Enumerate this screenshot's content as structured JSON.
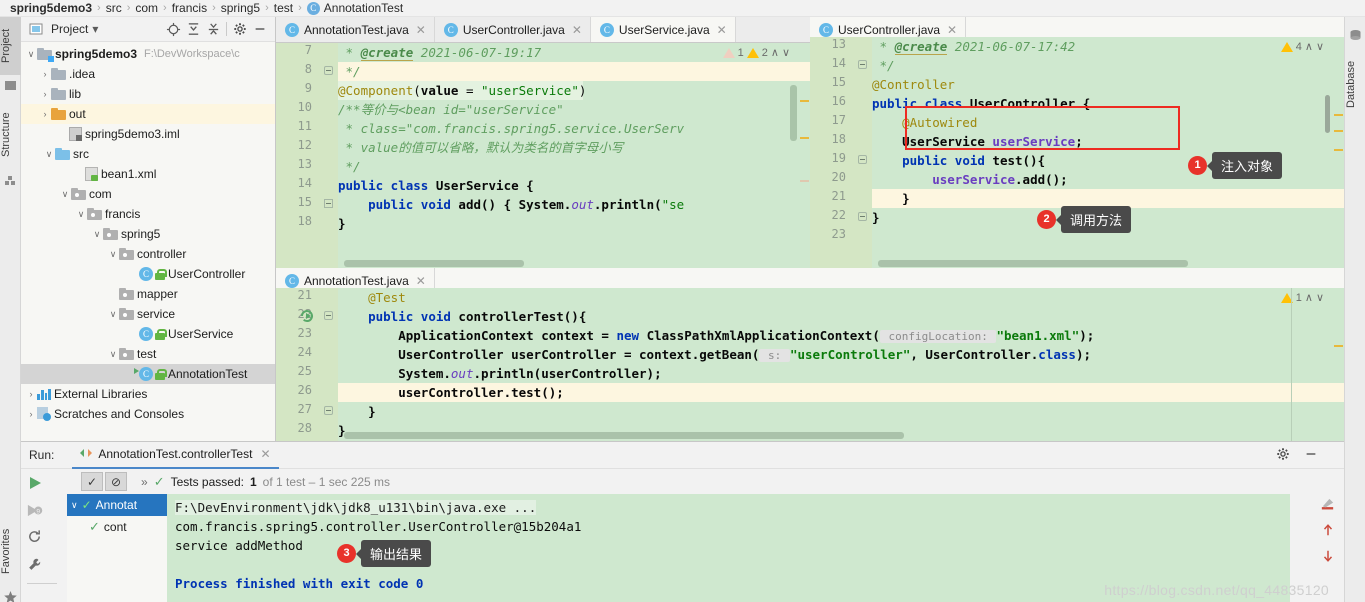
{
  "breadcrumb": {
    "items": [
      "spring5demo3",
      "src",
      "com",
      "francis",
      "spring5",
      "test",
      "AnnotationTest"
    ],
    "class_icon": "class-icon"
  },
  "left_strip": {
    "tabs": [
      {
        "label": "Project",
        "icon": "project-icon",
        "selected": true
      },
      {
        "label": "Structure",
        "icon": "structure-icon",
        "selected": false
      },
      {
        "label": "Favorites",
        "icon": "star-icon",
        "selected": false
      }
    ]
  },
  "right_strip": {
    "tabs": [
      {
        "label": "Database",
        "icon": "database-icon"
      }
    ]
  },
  "project_panel": {
    "title": "Project",
    "toolbar_icons": [
      "locate-icon",
      "expand-all-icon",
      "collapse-all-icon",
      "gear-icon",
      "hide-icon"
    ],
    "tree": [
      {
        "label": "spring5demo3",
        "path": "F:\\DevWorkspace\\c",
        "indent": 0,
        "arrow": "∨",
        "icon": "module-folder-icon",
        "bold": true
      },
      {
        "label": ".idea",
        "path": "",
        "indent": 1,
        "arrow": "›",
        "icon": "folder-icon",
        "bold": false
      },
      {
        "label": "lib",
        "path": "",
        "indent": 1,
        "arrow": "›",
        "icon": "folder-icon",
        "bold": false
      },
      {
        "label": "out",
        "path": "",
        "indent": 1,
        "arrow": "›",
        "icon": "folder-orange-icon",
        "bold": false,
        "highlight": true
      },
      {
        "label": "spring5demo3.iml",
        "path": "",
        "indent": 2,
        "arrow": "",
        "icon": "iml-file-icon",
        "bold": false
      },
      {
        "label": "src",
        "path": "",
        "indent": 1,
        "arrow": "∨",
        "icon": "source-folder-icon",
        "bold": false
      },
      {
        "label": "bean1.xml",
        "path": "",
        "indent": 3,
        "arrow": "",
        "icon": "xml-file-icon",
        "bold": false
      },
      {
        "label": "com",
        "path": "",
        "indent": 2,
        "arrow": "∨",
        "icon": "package-icon",
        "bold": false
      },
      {
        "label": "francis",
        "path": "",
        "indent": 3,
        "arrow": "∨",
        "icon": "package-icon",
        "bold": false
      },
      {
        "label": "spring5",
        "path": "",
        "indent": 4,
        "arrow": "∨",
        "icon": "package-icon",
        "bold": false
      },
      {
        "label": "controller",
        "path": "",
        "indent": 5,
        "arrow": "∨",
        "icon": "package-icon",
        "bold": false
      },
      {
        "label": "UserController",
        "path": "",
        "indent": 7,
        "arrow": "",
        "icon": "java-class-icon",
        "bold": false
      },
      {
        "label": "mapper",
        "path": "",
        "indent": 5,
        "arrow": "",
        "icon": "package-icon",
        "bold": false
      },
      {
        "label": "service",
        "path": "",
        "indent": 5,
        "arrow": "∨",
        "icon": "package-icon",
        "bold": false
      },
      {
        "label": "UserService",
        "path": "",
        "indent": 7,
        "arrow": "",
        "icon": "java-class-icon",
        "bold": false
      },
      {
        "label": "test",
        "path": "",
        "indent": 5,
        "arrow": "∨",
        "icon": "package-icon",
        "bold": false
      },
      {
        "label": "AnnotationTest",
        "path": "",
        "indent": 7,
        "arrow": "",
        "icon": "java-test-class-icon",
        "bold": false,
        "selected": true
      },
      {
        "label": "External Libraries",
        "path": "",
        "indent": 0,
        "arrow": "›",
        "icon": "libraries-icon",
        "bold": false
      },
      {
        "label": "Scratches and Consoles",
        "path": "",
        "indent": 0,
        "arrow": "›",
        "icon": "scratches-icon",
        "bold": false
      }
    ]
  },
  "editor_left": {
    "tabs": [
      {
        "label": "AnnotationTest.java",
        "icon": "test-class-icon",
        "active": false
      },
      {
        "label": "UserController.java",
        "icon": "class-icon",
        "active": false
      },
      {
        "label": "UserService.java",
        "icon": "class-icon",
        "active": true
      }
    ],
    "warnings": {
      "pale_count": "1",
      "yellow_count": "2",
      "up": "∧",
      "down": "∨"
    },
    "lines": [
      {
        "no": "7",
        "segments": [
          {
            "t": " * ",
            "c": "cmt"
          },
          {
            "t": "@create",
            "c": "cmtb"
          },
          {
            "t": " 2021-06-07-19:17",
            "c": "cmt"
          }
        ]
      },
      {
        "no": "8",
        "segments": [
          {
            "t": " */",
            "c": "cmt"
          }
        ]
      },
      {
        "no": "9",
        "highlight": "yellow",
        "segments": [
          {
            "t": "@Component",
            "c": "anno"
          },
          {
            "t": "(",
            "c": "plain"
          },
          {
            "t": "value",
            "c": "plain"
          },
          {
            "t": " = ",
            "c": "plain"
          },
          {
            "t": "\"userService\"",
            "c": "str"
          },
          {
            "t": ")",
            "c": "plain"
          }
        ]
      },
      {
        "no": "10",
        "segments": [
          {
            "t": "/**等价与<bean id=\"userService\"",
            "c": "cmt"
          }
        ]
      },
      {
        "no": "11",
        "segments": [
          {
            "t": " * class=\"com.francis.spring5.service.UserServ",
            "c": "cmt"
          }
        ]
      },
      {
        "no": "12",
        "segments": [
          {
            "t": " * value的值可以省略，默认为类名的首字母小写",
            "c": "cmt"
          }
        ]
      },
      {
        "no": "13",
        "segments": [
          {
            "t": " */",
            "c": "cmt"
          }
        ]
      },
      {
        "no": "14",
        "segments": [
          {
            "t": "public class ",
            "c": "kw"
          },
          {
            "t": "UserService {",
            "c": "plain"
          }
        ]
      },
      {
        "no": "15",
        "segments": [
          {
            "t": "    public void ",
            "c": "kw"
          },
          {
            "t": "add() { ",
            "c": "plain"
          },
          {
            "t": "System.",
            "c": "plain"
          },
          {
            "t": "out",
            "c": "fld"
          },
          {
            "t": ".println(",
            "c": "plain"
          },
          {
            "t": "\"se",
            "c": "str"
          }
        ]
      },
      {
        "no": "18",
        "segments": [
          {
            "t": "}",
            "c": "plain"
          }
        ]
      }
    ]
  },
  "editor_right": {
    "tabs": [
      {
        "label": "UserController.java",
        "icon": "class-icon",
        "active": true
      }
    ],
    "warnings": {
      "yellow_count": "4",
      "up": "∧",
      "down": "∨"
    },
    "lines": [
      {
        "no": "13",
        "segments": [
          {
            "t": " * ",
            "c": "cmt"
          },
          {
            "t": "@create",
            "c": "cmtb"
          },
          {
            "t": " 2021-06-07-17:42",
            "c": "cmt"
          }
        ]
      },
      {
        "no": "14",
        "segments": [
          {
            "t": " */",
            "c": "cmt"
          }
        ]
      },
      {
        "no": "15",
        "segments": [
          {
            "t": "@Controller",
            "c": "anno"
          }
        ]
      },
      {
        "no": "16",
        "segments": [
          {
            "t": "public class ",
            "c": "kw"
          },
          {
            "t": "UserController {",
            "c": "plain"
          }
        ]
      },
      {
        "no": "17",
        "segments": [
          {
            "t": "    @Autowired",
            "c": "anno"
          }
        ]
      },
      {
        "no": "18",
        "segments": [
          {
            "t": "    UserService ",
            "c": "plain"
          },
          {
            "t": "userService",
            "c": "fld"
          },
          {
            "t": ";",
            "c": "plain"
          }
        ]
      },
      {
        "no": "19",
        "segments": [
          {
            "t": "    public void ",
            "c": "kw"
          },
          {
            "t": "test(){",
            "c": "plain"
          }
        ]
      },
      {
        "no": "20",
        "highlight": "yellow",
        "segments": [
          {
            "t": "        ",
            "c": "plain"
          },
          {
            "t": "userService",
            "c": "fld"
          },
          {
            "t": ".add();",
            "c": "plain"
          }
        ]
      },
      {
        "no": "21",
        "segments": [
          {
            "t": "    }",
            "c": "plain"
          }
        ]
      },
      {
        "no": "22",
        "segments": [
          {
            "t": "}",
            "c": "plain"
          }
        ]
      },
      {
        "no": "23",
        "segments": [
          {
            "t": "",
            "c": "plain"
          }
        ]
      }
    ]
  },
  "editor_bottom": {
    "tabs": [
      {
        "label": "AnnotationTest.java",
        "icon": "test-class-icon",
        "active": true
      }
    ],
    "warnings": {
      "yellow_count": "1",
      "up": "∧",
      "down": "∨"
    },
    "lines": [
      {
        "no": "21",
        "segments": [
          {
            "t": "    @Test",
            "c": "anno"
          }
        ]
      },
      {
        "no": "22",
        "gutter_icon": "run-test-icon",
        "segments": [
          {
            "t": "    public void ",
            "c": "kw"
          },
          {
            "t": "controllerTest(){",
            "c": "plain"
          }
        ]
      },
      {
        "no": "23",
        "segments": [
          {
            "t": "        ApplicationContext context = ",
            "c": "plain"
          },
          {
            "t": "new ",
            "c": "kw"
          },
          {
            "t": "ClassPathXmlApplicationContext(",
            "c": "plain"
          },
          {
            "t": " configLocation: ",
            "c": "hint"
          },
          {
            "t": "\"bean1.xml\"",
            "c": "str"
          },
          {
            "t": ");",
            "c": "plain"
          }
        ]
      },
      {
        "no": "24",
        "segments": [
          {
            "t": "        UserController userController = context.getBean(",
            "c": "plain"
          },
          {
            "t": " s: ",
            "c": "hint"
          },
          {
            "t": "\"userController\"",
            "c": "str"
          },
          {
            "t": ", UserController.",
            "c": "plain"
          },
          {
            "t": "class",
            "c": "kw"
          },
          {
            "t": ");",
            "c": "plain"
          }
        ]
      },
      {
        "no": "25",
        "segments": [
          {
            "t": "        System.",
            "c": "plain"
          },
          {
            "t": "out",
            "c": "fld"
          },
          {
            "t": ".println(userController);",
            "c": "plain"
          }
        ]
      },
      {
        "no": "26",
        "highlight": "yellow",
        "segments": [
          {
            "t": "        userController.test();",
            "c": "plain"
          }
        ]
      },
      {
        "no": "27",
        "segments": [
          {
            "t": "    }",
            "c": "plain"
          }
        ]
      },
      {
        "no": "28",
        "segments": [
          {
            "t": "}",
            "c": "plain"
          }
        ]
      }
    ]
  },
  "callouts": [
    {
      "num": "1",
      "text": "注入对象"
    },
    {
      "num": "2",
      "text": "调用方法"
    },
    {
      "num": "3",
      "text": "输出结果"
    }
  ],
  "run_panel": {
    "label": "Run:",
    "tab_label": "AnnotationTest.controllerTest",
    "tab_icon": "run-config-icon",
    "toolbar_icons": [
      "rerun-icon",
      "rerun-failed-icon",
      "stop-icon",
      "debug-icon",
      "restart-icon",
      "wrench-icon"
    ],
    "status": {
      "expand": "»",
      "passed_label": "Tests passed:",
      "passed_count": "1",
      "detail": "of 1 test – 1 sec 225 ms"
    },
    "tests_tree": [
      {
        "label": "Annotat",
        "selected": true,
        "arrow": "∨"
      },
      {
        "label": "cont",
        "selected": false,
        "arrow": ""
      }
    ],
    "console_lines": [
      {
        "text": "F:\\DevEnvironment\\jdk\\jdk8_u131\\bin\\java.exe ...",
        "style": "dim"
      },
      {
        "text": "com.francis.spring5.controller.UserController@15b204a1",
        "style": "normal"
      },
      {
        "text": "service addMethod",
        "style": "normal"
      },
      {
        "text": "",
        "style": "normal"
      },
      {
        "text": "Process finished with exit code 0",
        "style": "blue"
      }
    ],
    "right_icons": [
      "soft-wrap-icon",
      "scroll-up-icon",
      "scroll-down-icon"
    ],
    "window_icons": [
      "gear-icon",
      "minimize-icon"
    ]
  },
  "watermark": "https://blog.csdn.net/qq_44835120",
  "colors": {
    "editor_bg": "#cfe8cf",
    "gutter_bg": "#d4e6c4",
    "highlight_line": "#fdf6e0",
    "redbox": "#ee2b22",
    "callout_badge": "#e8322a",
    "selection_blue": "#2675bf"
  }
}
